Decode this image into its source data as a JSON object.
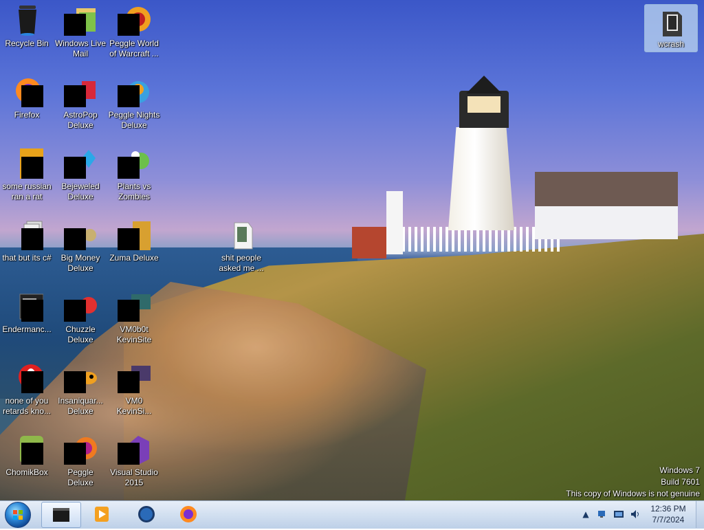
{
  "desktop": {
    "icons": [
      {
        "id": "recycle-bin",
        "label": "Recycle Bin",
        "icon": "recycle-bin-icon"
      },
      {
        "id": "windows-live-mail",
        "label": "Windows Live Mail",
        "icon": "mail-icon"
      },
      {
        "id": "peggle-world-of-warcraft",
        "label": "Peggle World of Warcraft ...",
        "icon": "peggle-icon"
      },
      {
        "id": "firefox",
        "label": "Firefox",
        "icon": "firefox-icon"
      },
      {
        "id": "astropop-deluxe",
        "label": "AstroPop Deluxe",
        "icon": "astropop-icon"
      },
      {
        "id": "peggle-nights-deluxe",
        "label": "Peggle Nights Deluxe",
        "icon": "peggle-nights-icon"
      },
      {
        "id": "some-russian-ran-a-rat",
        "label": "some russian ran a rat",
        "icon": "exe-icon"
      },
      {
        "id": "bejeweled-deluxe",
        "label": "Bejeweled Deluxe",
        "icon": "bejeweled-icon"
      },
      {
        "id": "plants-vs-zombies",
        "label": "Plants vs Zombies",
        "icon": "plants-vs-zombies-icon"
      },
      {
        "id": "that-but-its-csharp",
        "label": "that but its c#",
        "icon": "stack-icon"
      },
      {
        "id": "big-money-deluxe",
        "label": "Big Money Deluxe",
        "icon": "money-bag-icon"
      },
      {
        "id": "zuma-deluxe",
        "label": "Zuma Deluxe",
        "icon": "zuma-icon"
      },
      {
        "id": "shit-people-asked-me",
        "label": "shit people asked me ...",
        "icon": "folder-icon"
      },
      {
        "id": "endermanch",
        "label": "Endermanc...",
        "icon": "terminal-icon"
      },
      {
        "id": "chuzzle-deluxe",
        "label": "Chuzzle Deluxe",
        "icon": "chuzzle-icon"
      },
      {
        "id": "vm0b0t-kevinsite",
        "label": "VM0b0t KevinSite",
        "icon": "vm-icon"
      },
      {
        "id": "none-of-you-retards",
        "label": "none of you retards kno...",
        "icon": "opera-icon"
      },
      {
        "id": "insaniquarium-deluxe",
        "label": "Insaniquar... Deluxe",
        "icon": "fish-icon"
      },
      {
        "id": "vm0-kevinsi",
        "label": "VM0 KevinSi...",
        "icon": "vm-icon"
      },
      {
        "id": "chomikbox",
        "label": "ChomikBox",
        "icon": "chomikbox-icon"
      },
      {
        "id": "peggle-deluxe",
        "label": "Peggle Deluxe",
        "icon": "peggle-icon"
      },
      {
        "id": "visual-studio-2015",
        "label": "Visual Studio 2015",
        "icon": "visual-studio-icon"
      }
    ],
    "selected_icon": {
      "label": "wcrash",
      "icon": "folder-icon"
    },
    "watermark": {
      "line1": "Windows 7",
      "line2": "Build 7601",
      "line3": "This copy of Windows is not genuine"
    }
  },
  "taskbar": {
    "start_label": "Start",
    "pinned": [
      {
        "id": "active-window",
        "icon": "black-window-icon",
        "active": true
      },
      {
        "id": "media-player",
        "icon": "media-player-icon",
        "active": false
      },
      {
        "id": "globe",
        "icon": "globe-icon",
        "active": false
      },
      {
        "id": "firefox",
        "icon": "firefox-icon",
        "active": false
      }
    ],
    "tray": {
      "icons": [
        "show-hidden-icons-arrow",
        "network-icon",
        "action-center-icon",
        "volume-icon"
      ],
      "time": "12:36 PM",
      "date": "7/7/2024"
    }
  },
  "colors": {
    "icon_label": "#ffffff",
    "taskbar": "#d4e1f1",
    "sky": "#5b74d8",
    "mask": "#000000"
  }
}
